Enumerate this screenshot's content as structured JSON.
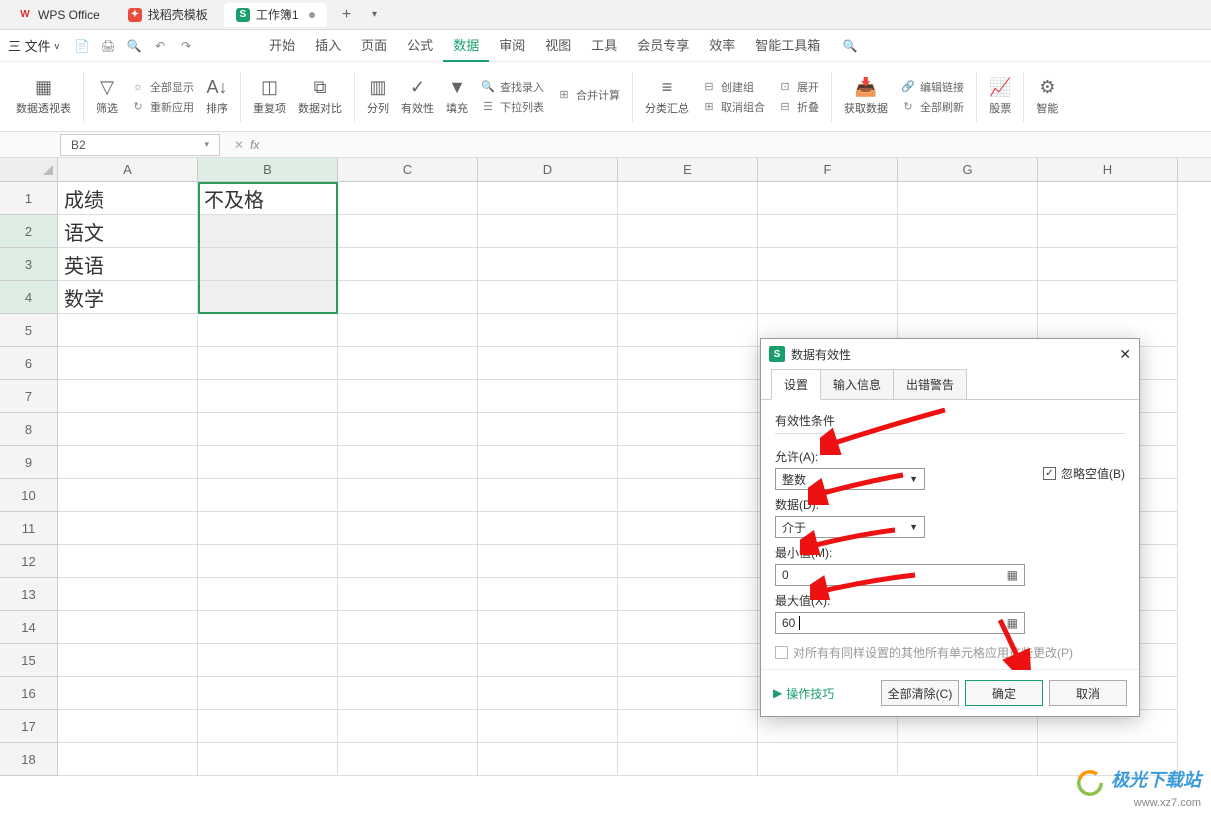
{
  "tabs": {
    "wps": "WPS Office",
    "template": "找稻壳模板",
    "workbook": "工作簿1"
  },
  "menu": {
    "file": "三 文件",
    "items": [
      "开始",
      "插入",
      "页面",
      "公式",
      "数据",
      "审阅",
      "视图",
      "工具",
      "会员专享",
      "效率",
      "智能工具箱"
    ],
    "activeIndex": 4
  },
  "ribbon": {
    "pivot": "数据透视表",
    "filter": "筛选",
    "showall": "全部显示",
    "reapply": "重新应用",
    "sort": "排序",
    "dup": "重复项",
    "compare": "数据对比",
    "split": "分列",
    "valid": "有效性",
    "fill": "填充",
    "findrec": "查找录入",
    "merge": "合并计算",
    "droplist": "下拉列表",
    "subtotal": "分类汇总",
    "group": "创建组",
    "ungroup": "取消组合",
    "expand": "展开",
    "collapse": "折叠",
    "getdata": "获取数据",
    "editlink": "编辑链接",
    "refreshall": "全部刷新",
    "stock": "股票",
    "smart": "智能"
  },
  "namebox": "B2",
  "cols": [
    "A",
    "B",
    "C",
    "D",
    "E",
    "F",
    "G",
    "H"
  ],
  "rows": [
    "1",
    "2",
    "3",
    "4",
    "5",
    "6",
    "7",
    "8",
    "9",
    "10",
    "11",
    "12",
    "13",
    "14",
    "15",
    "16",
    "17",
    "18"
  ],
  "cells": {
    "A1": "成绩",
    "B1": "不及格",
    "A2": "语文",
    "A3": "英语",
    "A4": "数学"
  },
  "dialog": {
    "title": "数据有效性",
    "tabs": [
      "设置",
      "输入信息",
      "出错警告"
    ],
    "group": "有效性条件",
    "allow_label": "允许(A):",
    "allow_value": "整数",
    "ignore_blank": "忽略空值(B)",
    "data_label": "数据(D):",
    "data_value": "介于",
    "min_label": "最小值(M):",
    "min_value": "0",
    "max_label": "最大值(X):",
    "max_value": "60",
    "applyall": "对所有有同样设置的其他所有单元格应用这些更改(P)",
    "tips": "操作技巧",
    "clear": "全部清除(C)",
    "ok": "确定",
    "cancel": "取消"
  },
  "watermark": {
    "name": "极光下载站",
    "url": "www.xz7.com"
  }
}
